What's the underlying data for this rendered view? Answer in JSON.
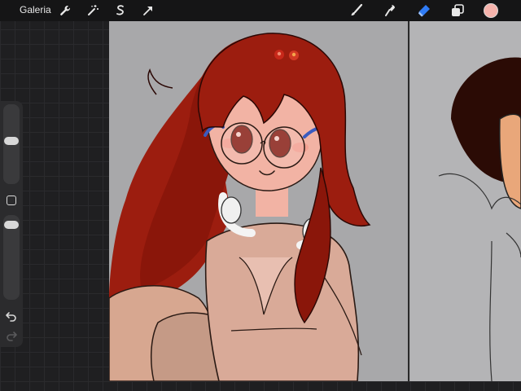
{
  "toolbar": {
    "gallery_label": "Galeria",
    "left_icons": [
      "wrench-icon",
      "magic-wand-icon",
      "selection-icon",
      "transform-arrow-icon"
    ],
    "right_icons": [
      "brush-icon",
      "smudge-icon",
      "eraser-icon",
      "layers-icon"
    ],
    "current_color": "#f6b3ac",
    "active_tool": "eraser"
  },
  "sidebar": {
    "brush_size_level": 0.55,
    "opacity_level": 0.05
  },
  "canvas": {
    "background": "#a8a8aa",
    "hair_color": "#9c1d0f",
    "skin_color": "#f2b3a4",
    "outfit_color": "#d9aa98"
  }
}
